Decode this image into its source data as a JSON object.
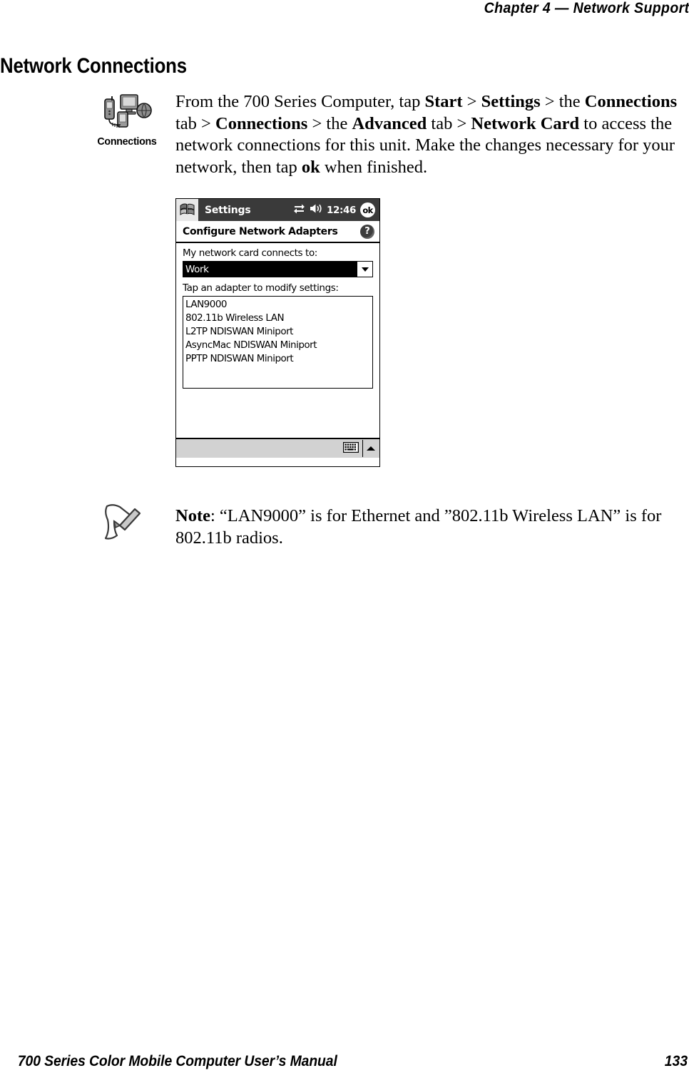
{
  "header": {
    "text": "Chapter  4  —  Network Support"
  },
  "section": {
    "title": "Network Connections"
  },
  "callout": {
    "icon_name": "connections-icon",
    "icon_label": "Connections",
    "paragraph": {
      "p1": "From the 700 Series Computer, tap ",
      "b1": "Start",
      "p2": " > ",
      "b2": "Settings",
      "p3": " > the ",
      "b3": "Connections",
      "p4": " tab > ",
      "b4": "Connections",
      "p5": " > the ",
      "b5": "Advanced",
      "p6": " tab > ",
      "b6": "Network Card",
      "p7": " to access the network connections for this unit. Make the changes necessary for your network, then tap ",
      "b7": "ok",
      "p8": " when finished."
    }
  },
  "pda": {
    "titlebar": {
      "start_icon": "windows-flag-icon",
      "title": "Settings",
      "connectivity_icon": "connectivity-icon",
      "volume_icon": "speaker-icon",
      "clock": "12:46",
      "ok_label": "ok"
    },
    "subheader": {
      "title": "Configure Network Adapters",
      "help_label": "?"
    },
    "network_card_label": "My network card connects to:",
    "network_card_value": "Work",
    "adapter_label": "Tap an adapter to modify settings:",
    "adapters": [
      "LAN9000",
      "802.11b Wireless LAN",
      "L2TP NDISWAN Miniport",
      "AsyncMac NDISWAN Miniport",
      "PPTP NDISWAN Miniport"
    ],
    "bottombar": {
      "keyboard_icon": "keyboard-icon",
      "sip_arrow_icon": "caret-up-icon"
    }
  },
  "note": {
    "icon_name": "note-pencil-icon",
    "label": "Note",
    "text": ": “LAN9000” is for Ethernet and ”802.11b Wireless LAN” is for 802.11b radios."
  },
  "footer": {
    "manual_title": "700 Series Color Mobile Computer User’s Manual",
    "page_number": "133"
  }
}
